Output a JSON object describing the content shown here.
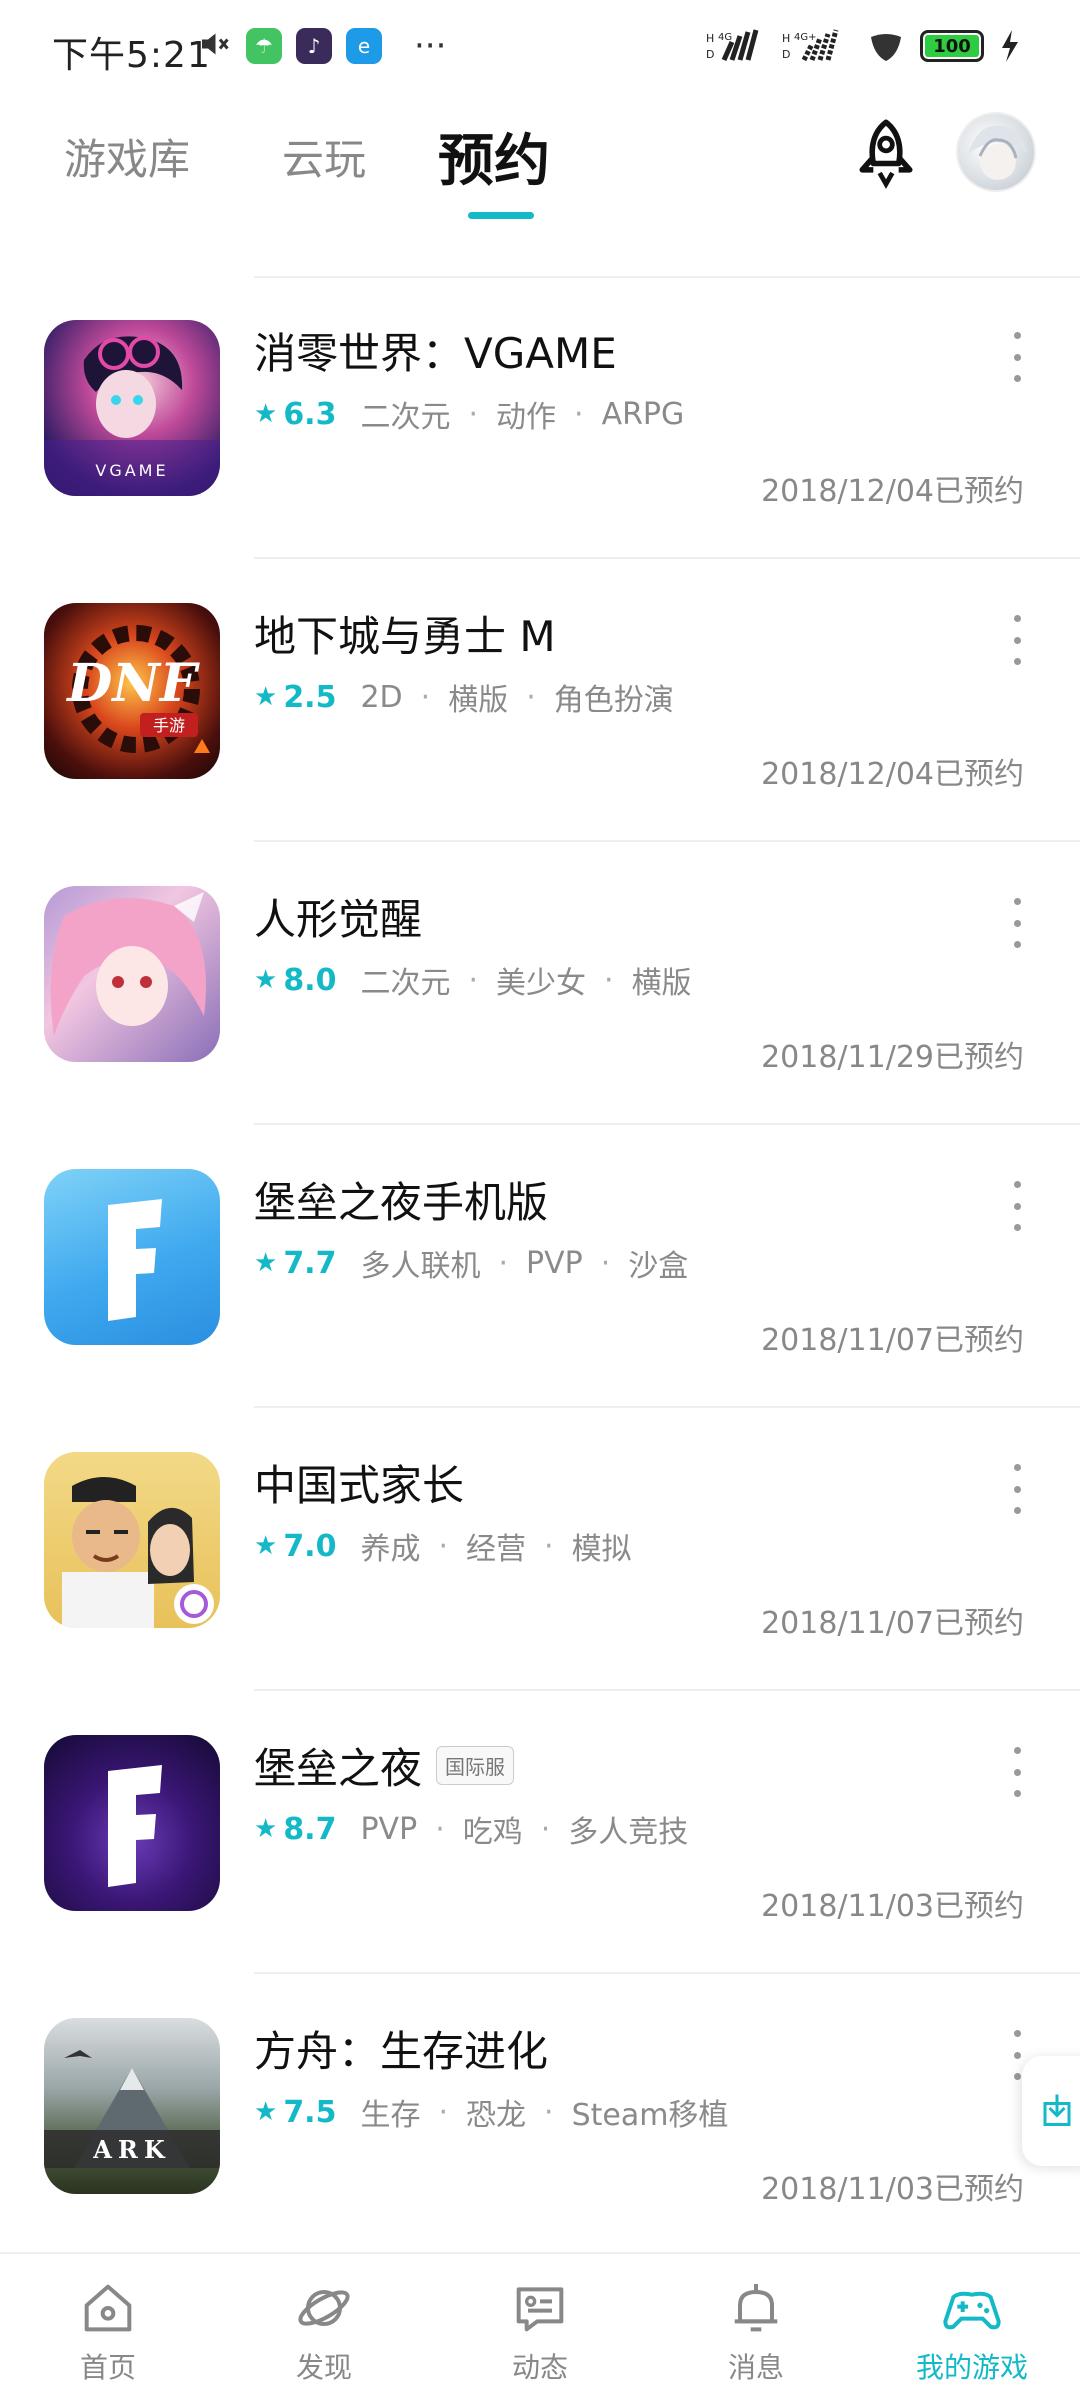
{
  "status_bar": {
    "time": "下午5:21",
    "battery": "100",
    "network_1": "4G",
    "network_2": "4G+"
  },
  "header": {
    "tabs": [
      {
        "label": "游戏库",
        "active": false
      },
      {
        "label": "云玩",
        "active": false
      },
      {
        "label": "预约",
        "active": true
      }
    ],
    "accent_color": "#14b9c8"
  },
  "games": [
    {
      "title": "消零世界：VGAME",
      "badge": "",
      "score": "6.3",
      "tags": [
        "二次元",
        "动作",
        "ARPG"
      ],
      "date": "2018/12/04已预约",
      "icon_text": "VGAME"
    },
    {
      "title": "地下城与勇士 M",
      "badge": "",
      "score": "2.5",
      "tags": [
        "2D",
        "横版",
        "角色扮演"
      ],
      "date": "2018/12/04已预约",
      "icon_text": "DNF"
    },
    {
      "title": "人形觉醒",
      "badge": "",
      "score": "8.0",
      "tags": [
        "二次元",
        "美少女",
        "横版"
      ],
      "date": "2018/11/29已预约",
      "icon_text": ""
    },
    {
      "title": "堡垒之夜手机版",
      "badge": "",
      "score": "7.7",
      "tags": [
        "多人联机",
        "PVP",
        "沙盒"
      ],
      "date": "2018/11/07已预约",
      "icon_text": "F"
    },
    {
      "title": "中国式家长",
      "badge": "",
      "score": "7.0",
      "tags": [
        "养成",
        "经营",
        "模拟"
      ],
      "date": "2018/11/07已预约",
      "icon_text": ""
    },
    {
      "title": "堡垒之夜",
      "badge": "国际服",
      "score": "8.7",
      "tags": [
        "PVP",
        "吃鸡",
        "多人竞技"
      ],
      "date": "2018/11/03已预约",
      "icon_text": "F"
    },
    {
      "title": "方舟：生存进化",
      "badge": "",
      "score": "7.5",
      "tags": [
        "生存",
        "恐龙",
        "Steam移植"
      ],
      "date": "2018/11/03已预约",
      "icon_text": "ARK"
    }
  ],
  "bottom_nav": [
    {
      "label": "首页",
      "icon": "home-icon",
      "active": false
    },
    {
      "label": "发现",
      "icon": "compass-planet-icon",
      "active": false
    },
    {
      "label": "动态",
      "icon": "chat-bubble-icon",
      "active": false
    },
    {
      "label": "消息",
      "icon": "bell-icon",
      "active": false
    },
    {
      "label": "我的游戏",
      "icon": "gamepad-icon",
      "active": true
    }
  ]
}
